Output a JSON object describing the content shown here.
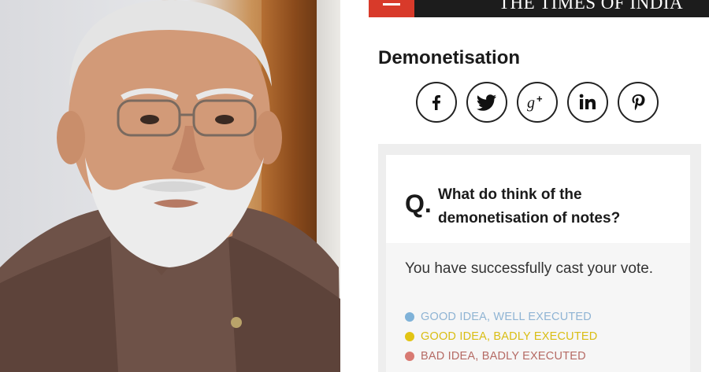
{
  "header": {
    "brand": "THE TIMES OF INDIA"
  },
  "article": {
    "section_title": "Demonetisation"
  },
  "share_buttons": [
    {
      "name": "facebook",
      "glyph": "f"
    },
    {
      "name": "twitter",
      "glyph": ""
    },
    {
      "name": "google-plus",
      "glyph": "g+"
    },
    {
      "name": "linkedin",
      "glyph": "in"
    },
    {
      "name": "pinterest",
      "glyph": "p"
    }
  ],
  "poll": {
    "q_label": "Q.",
    "question": "What do think of the demonetisation of notes?",
    "status": "You have successfully cast your vote.",
    "options": [
      {
        "label": "GOOD IDEA, WELL EXECUTED",
        "color": "#7fb2d8"
      },
      {
        "label": "GOOD IDEA, BADLY EXECUTED",
        "color": "#e2c414"
      },
      {
        "label": "BAD IDEA, BADLY EXECUTED",
        "color": "#d87a72"
      }
    ]
  }
}
